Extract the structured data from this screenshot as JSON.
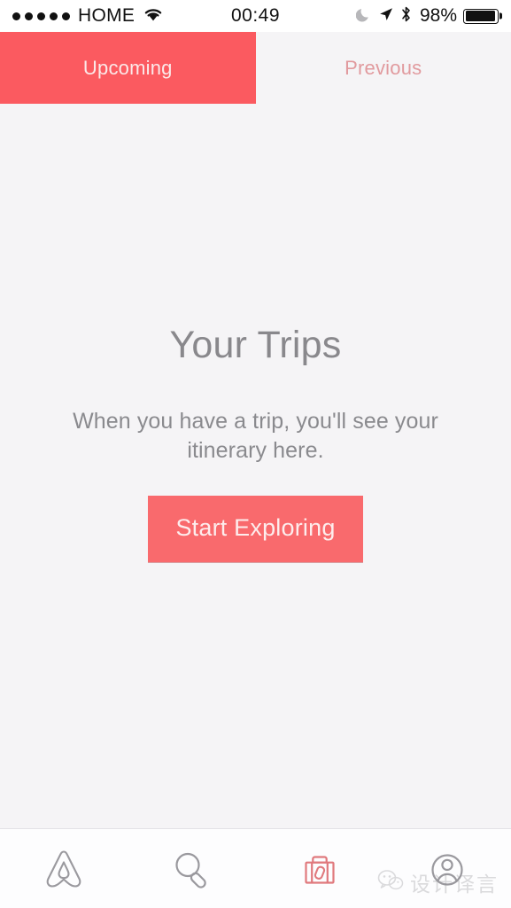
{
  "status_bar": {
    "signal_dots": 5,
    "carrier": "HOME",
    "wifi_icon": "wifi-icon",
    "clock": "00:49",
    "do_not_disturb_icon": "moon-icon",
    "location_icon": "location-arrow-icon",
    "bluetooth_icon": "bluetooth-icon",
    "battery_percent": "98%",
    "battery_icon": "battery-icon"
  },
  "segment": {
    "tabs": [
      {
        "label": "Upcoming",
        "active": true
      },
      {
        "label": "Previous",
        "active": false
      }
    ]
  },
  "empty_state": {
    "title": "Your Trips",
    "subtitle": "When you have a trip, you'll see your itinerary here.",
    "cta_label": "Start Exploring"
  },
  "tabbar": {
    "items": [
      {
        "name": "home",
        "icon": "airbnb-belo-icon",
        "active": false
      },
      {
        "name": "search",
        "icon": "search-icon",
        "active": false
      },
      {
        "name": "trips",
        "icon": "suitcase-icon",
        "active": true
      },
      {
        "name": "profile",
        "icon": "profile-icon",
        "active": false
      }
    ]
  },
  "watermark": {
    "icon": "wechat-icon",
    "text": "设计译言"
  },
  "colors": {
    "accent": "#FB5A60",
    "cta": "#F96A6D",
    "background": "#F5F4F6",
    "inactive_tab_text": "#E19A9E",
    "title_text": "#89888C",
    "icon_inactive": "#9A999E"
  }
}
